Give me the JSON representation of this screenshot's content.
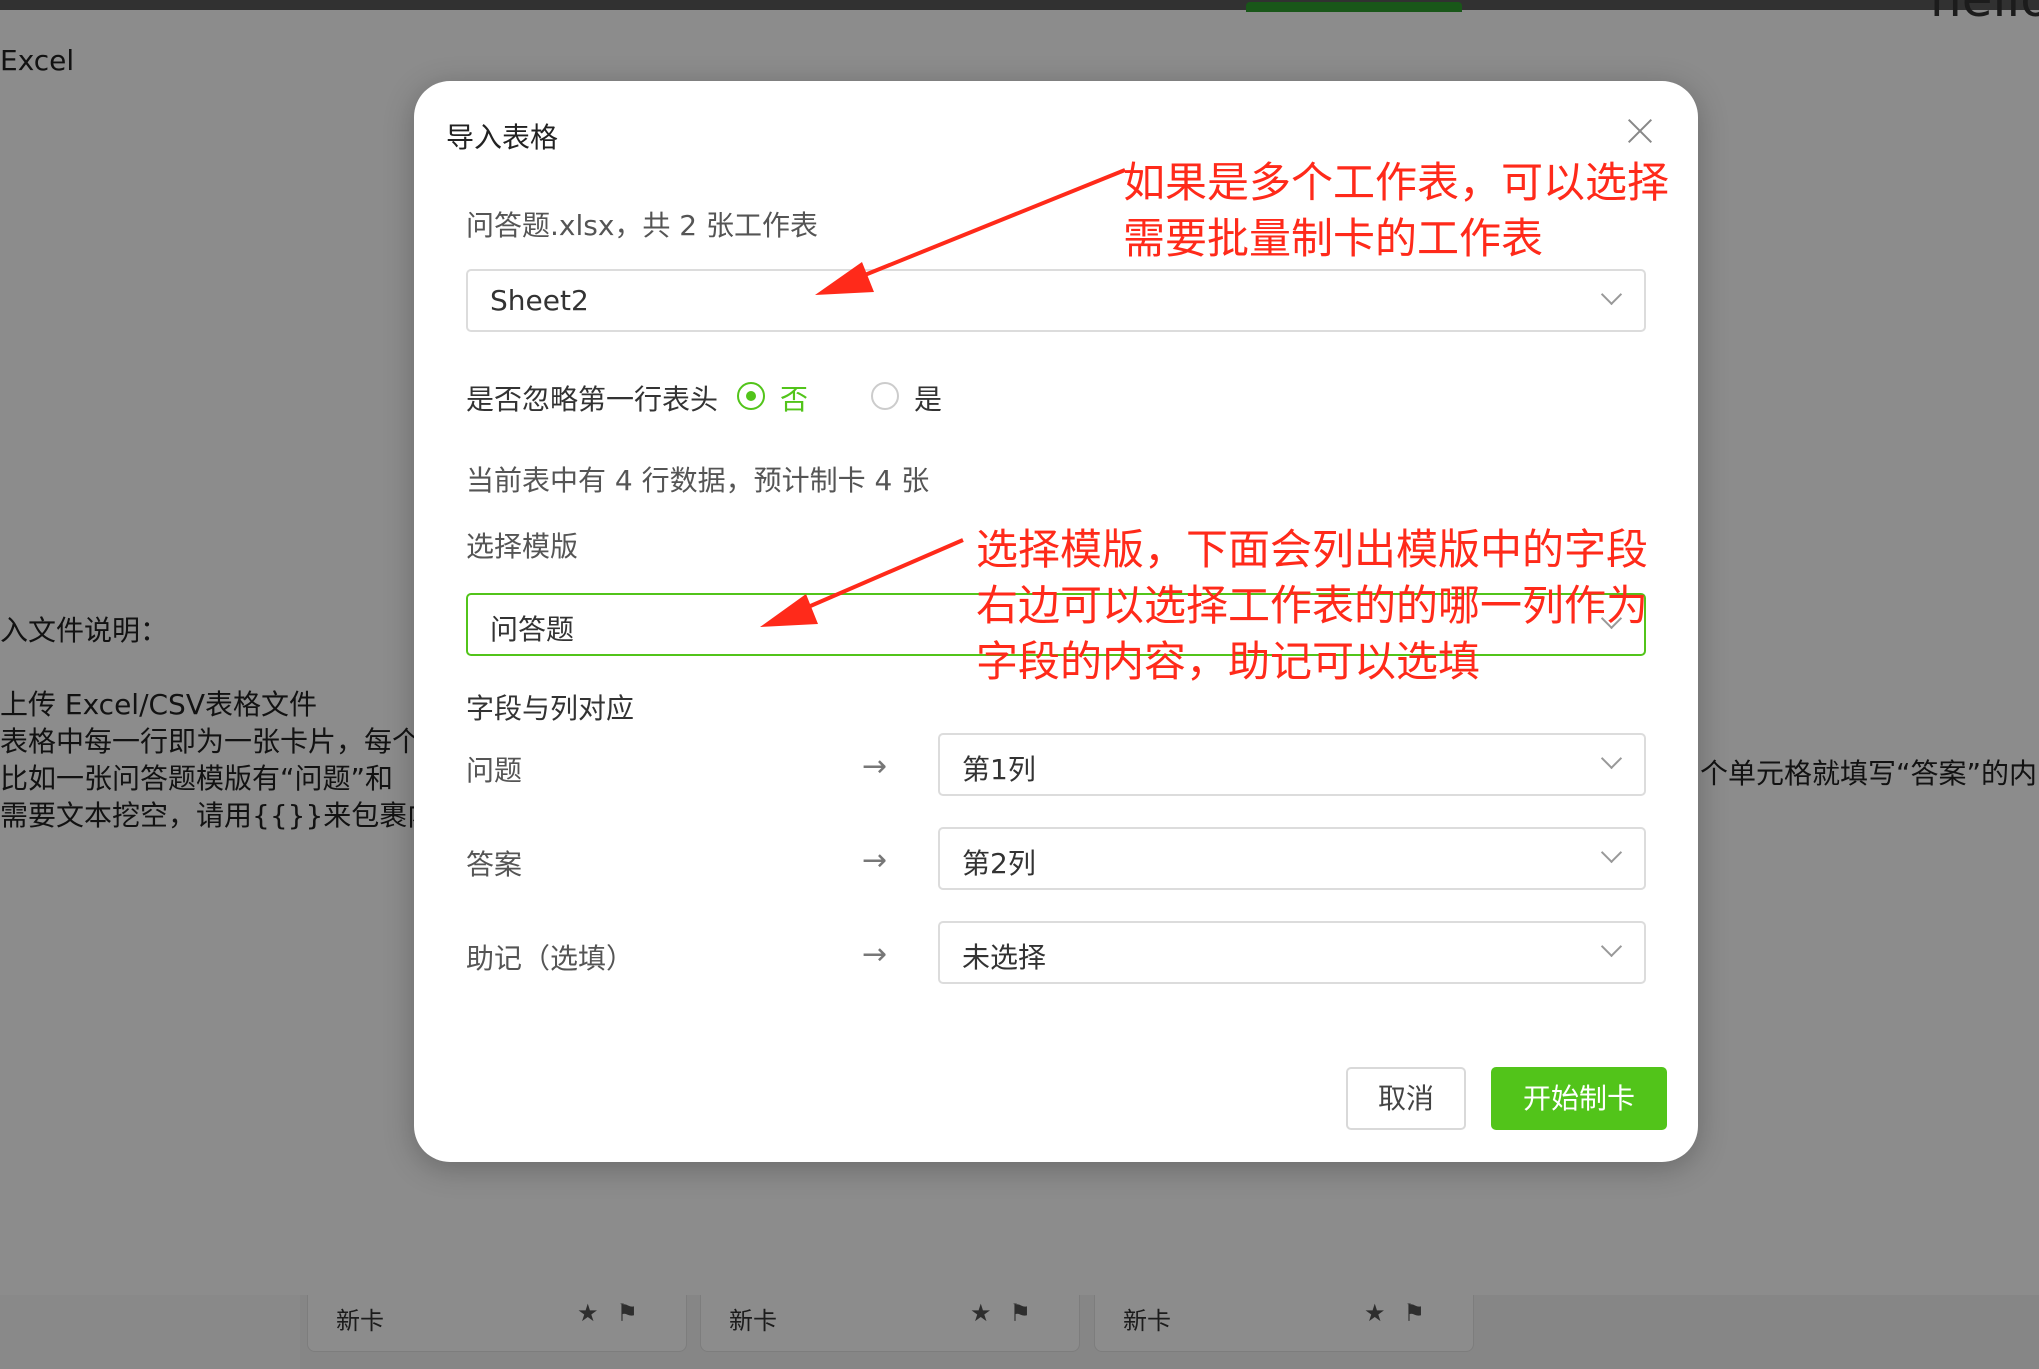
{
  "background": {
    "corner_text": "hello",
    "page_title": "Excel",
    "notes": [
      "入文件说明：",
      "",
      "上传 Excel/CSV表格文件",
      "表格中每一行即为一张卡片，每个",
      "比如一张问答题模版有“问题”和",
      "需要文本挖空，请用{{}}来包裹内容"
    ],
    "right_text": "个单元格就填写“答案”的内",
    "cards": [
      {
        "label": "新卡"
      },
      {
        "label": "新卡"
      },
      {
        "label": "新卡"
      }
    ]
  },
  "modal": {
    "title": "导入表格",
    "file_info": "问答题.xlsx，共 2 张工作表",
    "sheet_select": "Sheet2",
    "ignore_header": {
      "label": "是否忽略第一行表头",
      "option_no": "否",
      "option_yes": "是",
      "selected": "否"
    },
    "row_count": "当前表中有 4 行数据，预计制卡 4 张",
    "template_label": "选择模版",
    "template_select": "问答题",
    "field_map_label": "字段与列对应",
    "fields": [
      {
        "name": "问题",
        "arrow": "→",
        "column": "第1列"
      },
      {
        "name": "答案",
        "arrow": "→",
        "column": "第2列"
      },
      {
        "name": "助记（选填）",
        "arrow": "→",
        "column": "未选择"
      }
    ],
    "cancel_label": "取消",
    "start_label": "开始制卡"
  },
  "annotations": {
    "note1_line1": "如果是多个工作表，可以选择",
    "note1_line2": "需要批量制卡的工作表",
    "note2_line1": "选择模版，下面会列出模版中的字段",
    "note2_line2": "右边可以选择工作表的的哪一列作为",
    "note2_line3": "字段的内容，助记可以选填",
    "color": "#ff2a1a"
  },
  "colors": {
    "accent": "#52c41a",
    "overlay": "rgba(0,0,0,0.45)"
  }
}
